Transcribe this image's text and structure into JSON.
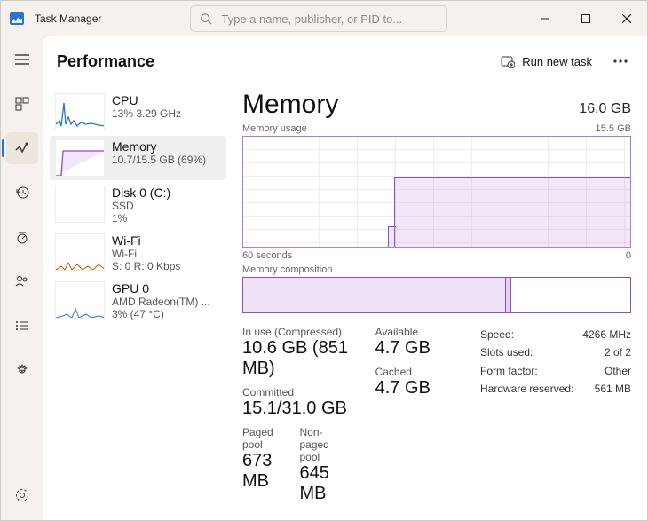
{
  "window": {
    "title": "Task Manager"
  },
  "search": {
    "placeholder": "Type a name, publisher, or PID to..."
  },
  "page": {
    "title": "Performance",
    "run_new_task": "Run new task"
  },
  "sidebar": {
    "items": [
      {
        "label": "CPU",
        "sub": "13% 3.29 GHz"
      },
      {
        "label": "Memory",
        "sub": "10.7/15.5 GB (69%)"
      },
      {
        "label": "Disk 0 (C:)",
        "sub1": "SSD",
        "sub2": "1%"
      },
      {
        "label": "Wi-Fi",
        "sub1": "Wi-Fi",
        "sub2": "S: 0 R: 0 Kbps"
      },
      {
        "label": "GPU 0",
        "sub1": "AMD Radeon(TM) ...",
        "sub2": "3% (47 °C)"
      }
    ]
  },
  "memory": {
    "title": "Memory",
    "capacity": "16.0 GB",
    "usage_label": "Memory usage",
    "usage_max": "15.5 GB",
    "axis_left": "60 seconds",
    "axis_right": "0",
    "composition_label": "Memory composition",
    "in_use_label": "In use (Compressed)",
    "in_use_value": "10.6 GB (851 MB)",
    "available_label": "Available",
    "available_value": "4.7 GB",
    "committed_label": "Committed",
    "committed_value": "15.1/31.0 GB",
    "cached_label": "Cached",
    "cached_value": "4.7 GB",
    "paged_label": "Paged pool",
    "paged_value": "673 MB",
    "nonpaged_label": "Non-paged pool",
    "nonpaged_value": "645 MB",
    "speed_label": "Speed:",
    "speed_value": "4266 MHz",
    "slots_label": "Slots used:",
    "slots_value": "2 of 2",
    "form_label": "Form factor:",
    "form_value": "Other",
    "hw_label": "Hardware reserved:",
    "hw_value": "561 MB"
  },
  "chart_data": {
    "type": "area",
    "title": "Memory usage",
    "xlabel": "seconds ago",
    "ylabel": "GB",
    "x_range": [
      60,
      0
    ],
    "ylim": [
      0,
      15.5
    ],
    "series": [
      {
        "name": "Memory usage (GB)",
        "x": [
          60,
          40,
          38,
          37,
          36,
          0
        ],
        "values": [
          0,
          0,
          5.0,
          10.5,
          10.7,
          10.7
        ]
      }
    ]
  }
}
